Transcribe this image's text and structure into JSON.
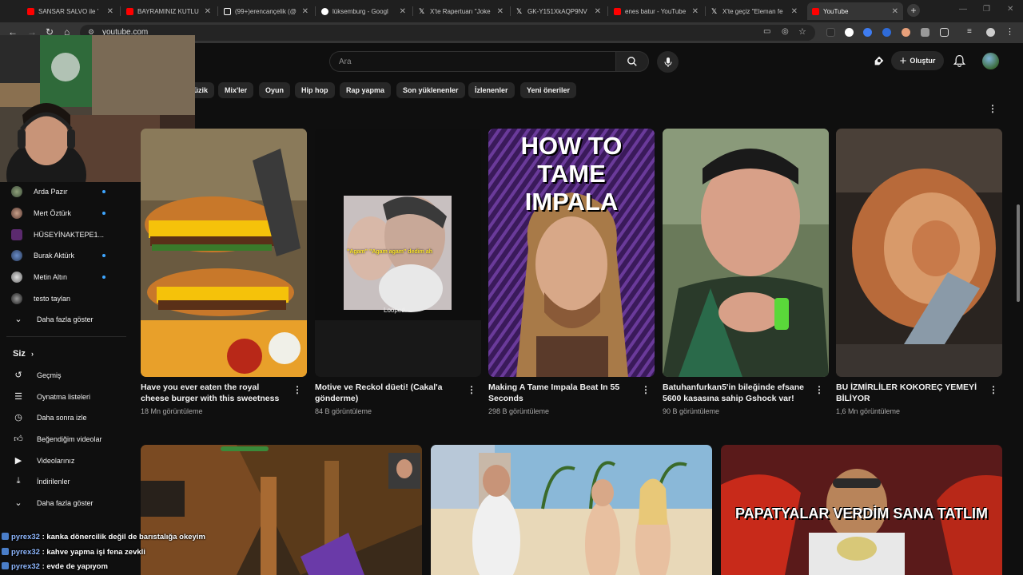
{
  "browser": {
    "tabs": [
      {
        "title": "SANSAR SALVO ile '",
        "favicon_color": "#ff0000"
      },
      {
        "title": "BAYRAMINIZ KUTLU",
        "favicon_color": "#ff0000"
      },
      {
        "title": "(99+)erencançelik (@",
        "favicon_color": "#ffffff"
      },
      {
        "title": "lüksemburg - Googl",
        "favicon_color": "#4285f4"
      },
      {
        "title": "X'te Rapertuarı \"Joke",
        "favicon_color": "#ffffff"
      },
      {
        "title": "GK-Y151XkAQP9NV",
        "favicon_color": "#ffffff"
      },
      {
        "title": "enes batur - YouTube",
        "favicon_color": "#ff0000"
      },
      {
        "title": "X'te geçiz \"Eleman fe",
        "favicon_color": "#ffffff"
      },
      {
        "title": "YouTube",
        "favicon_color": "#ff0000",
        "active": true
      }
    ],
    "url": "youtube.com"
  },
  "header": {
    "search_placeholder": "Ara",
    "create_label": "Oluştur"
  },
  "chips": [
    "Müzik",
    "Mix'ler",
    "Oyun",
    "Hip hop",
    "Rap yapma",
    "Son yüklenenler",
    "İzlenenler",
    "Yeni öneriler"
  ],
  "sidebar": {
    "subscriptions": [
      {
        "name": "Arda Pazır",
        "live": true
      },
      {
        "name": "Mert Öztürk",
        "live": true
      },
      {
        "name": "HÜSEYİNAKTEPE1...",
        "live": false
      },
      {
        "name": "Burak Aktürk",
        "live": true
      },
      {
        "name": "Metin Altın",
        "live": true
      },
      {
        "name": "testo taylan",
        "live": false
      }
    ],
    "more_subs": "Daha fazla göster",
    "you_heading": "Siz",
    "you_items": [
      "Geçmiş",
      "Oynatma listeleri",
      "Daha sonra izle",
      "Beğendiğim videolar",
      "Videolarınız",
      "İndirilenler",
      "Daha fazla göster"
    ]
  },
  "videos": [
    {
      "title": "Have you ever eaten the royal cheese burger with this sweetness",
      "views": "18 Mn görüntüleme"
    },
    {
      "title": "Motive ve Reckol düeti! (Cakal'a gönderme)",
      "views": "84 B görüntüleme",
      "overlay_text": "\"Agam\" \"Agam agam\" dedim ah",
      "overlay_brand": "Looped."
    },
    {
      "title": "Making A Tame Impala Beat In 55 Seconds",
      "views": "298 B görüntüleme",
      "overlay_text": "HOW TO TAME IMPALA"
    },
    {
      "title": "Batuhanfurkan5'in bileğinde efsane 5600 kasasına sahip Gshock var!",
      "views": "90 B görüntüleme"
    },
    {
      "title": "BU İZMİRLİLER KOKOREÇ YEMEYİ BİLİYOR",
      "views": "1,6 Mn görüntüleme"
    }
  ],
  "row2": [
    {
      "overlay_text": ""
    },
    {
      "overlay_text": ""
    },
    {
      "overlay_text": "PAPATYALAR VERDİM SANA TATLIM"
    }
  ],
  "chat": [
    {
      "user": "pyrex32",
      "message": ": kanka dönercilik değil de barıstalığa okeyim"
    },
    {
      "user": "pyrex32",
      "message": ": kahve yapma işi fena zevkli"
    },
    {
      "user": "pyrex32",
      "message": ": evde de yapıyom"
    }
  ],
  "colors": {
    "background": "#0f0f0f",
    "chip": "#272727",
    "text": "#f1f1f1",
    "meta": "#aaaaaa",
    "live_dot": "#3ea6ff"
  }
}
